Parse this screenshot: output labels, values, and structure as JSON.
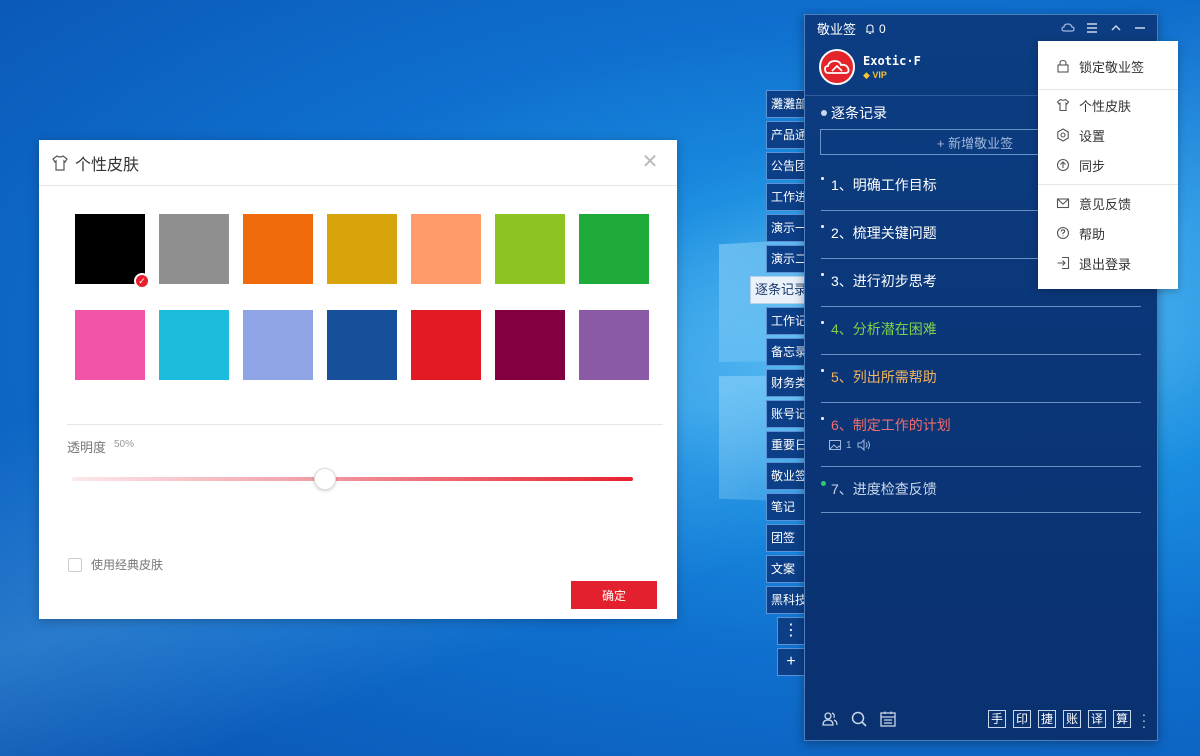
{
  "skin_dialog": {
    "title": "个性皮肤",
    "close_icon": "close-icon",
    "swatches": [
      {
        "color": "#000000",
        "selected": true
      },
      {
        "color": "#8f8f8f",
        "selected": false
      },
      {
        "color": "#ee6a0a",
        "selected": false
      },
      {
        "color": "#d8a40b",
        "selected": false
      },
      {
        "color": "#ff9b6a",
        "selected": false
      },
      {
        "color": "#8ec421",
        "selected": false
      },
      {
        "color": "#1fab3a",
        "selected": false
      },
      {
        "color": "#f254a8",
        "selected": false
      },
      {
        "color": "#1cbcdc",
        "selected": false
      },
      {
        "color": "#8fa4e4",
        "selected": false
      },
      {
        "color": "#16509a",
        "selected": false
      },
      {
        "color": "#e31a24",
        "selected": false
      },
      {
        "color": "#820041",
        "selected": false
      },
      {
        "color": "#8a5aa6",
        "selected": false
      }
    ],
    "opacity_label": "透明度",
    "opacity_value_text": "50%",
    "opacity_value": 0.5,
    "classic_skin_label": "使用经典皮肤",
    "classic_skin_checked": false,
    "ok_button": "确定"
  },
  "side_tabs": [
    {
      "label": "灘灘部",
      "active": false
    },
    {
      "label": "产品通",
      "active": false
    },
    {
      "label": "公告团",
      "active": false
    },
    {
      "label": "工作进",
      "active": false
    },
    {
      "label": "演示一",
      "active": false
    },
    {
      "label": "演示二",
      "active": false
    },
    {
      "label": "逐条记录",
      "active": true
    },
    {
      "label": "工作记",
      "active": false
    },
    {
      "label": "备忘录",
      "active": false
    },
    {
      "label": "财务类",
      "active": false
    },
    {
      "label": "账号记",
      "active": false
    },
    {
      "label": "重要日",
      "active": false
    },
    {
      "label": "敬业签",
      "active": false
    },
    {
      "label": "笔记",
      "active": false
    },
    {
      "label": "团签",
      "active": false
    },
    {
      "label": "文案",
      "active": false
    },
    {
      "label": "黑科技",
      "active": false
    }
  ],
  "side_tabs_more": "⋮",
  "side_tabs_add": "+",
  "panel": {
    "app_title": "敬业签",
    "notification_count": "0",
    "user": {
      "name": "Exotic·F",
      "badge": "VIP"
    },
    "section_title": "逐条记录",
    "add_note_label": "+ 新增敬业签",
    "notes": [
      {
        "text": "1、明确工作目标",
        "color": "#ffffff"
      },
      {
        "text": "2、梳理关键问题",
        "color": "#ffffff"
      },
      {
        "text": "3、进行初步思考",
        "color": "#ffffff"
      },
      {
        "text": "4、分析潜在困难",
        "color": "#7fd04a"
      },
      {
        "text": "5、列出所需帮助",
        "color": "#f3b45c"
      },
      {
        "text": "6、制定工作的计划",
        "color": "#f26d6d",
        "attachments": "1"
      },
      {
        "text": "7、进度检查反馈",
        "color": "#c9d7ea",
        "done": true
      }
    ],
    "bottom_tools": [
      "手",
      "印",
      "捷",
      "账",
      "译",
      "算"
    ]
  },
  "menu": {
    "items": [
      {
        "label": "锁定敬业签",
        "icon": "lock-icon"
      },
      {
        "label": "个性皮肤",
        "icon": "shirt-icon"
      },
      {
        "label": "设置",
        "icon": "settings-icon"
      },
      {
        "label": "同步",
        "icon": "sync-icon"
      },
      {
        "label": "意见反馈",
        "icon": "mail-icon"
      },
      {
        "label": "帮助",
        "icon": "help-icon"
      },
      {
        "label": "退出登录",
        "icon": "logout-icon"
      }
    ]
  }
}
